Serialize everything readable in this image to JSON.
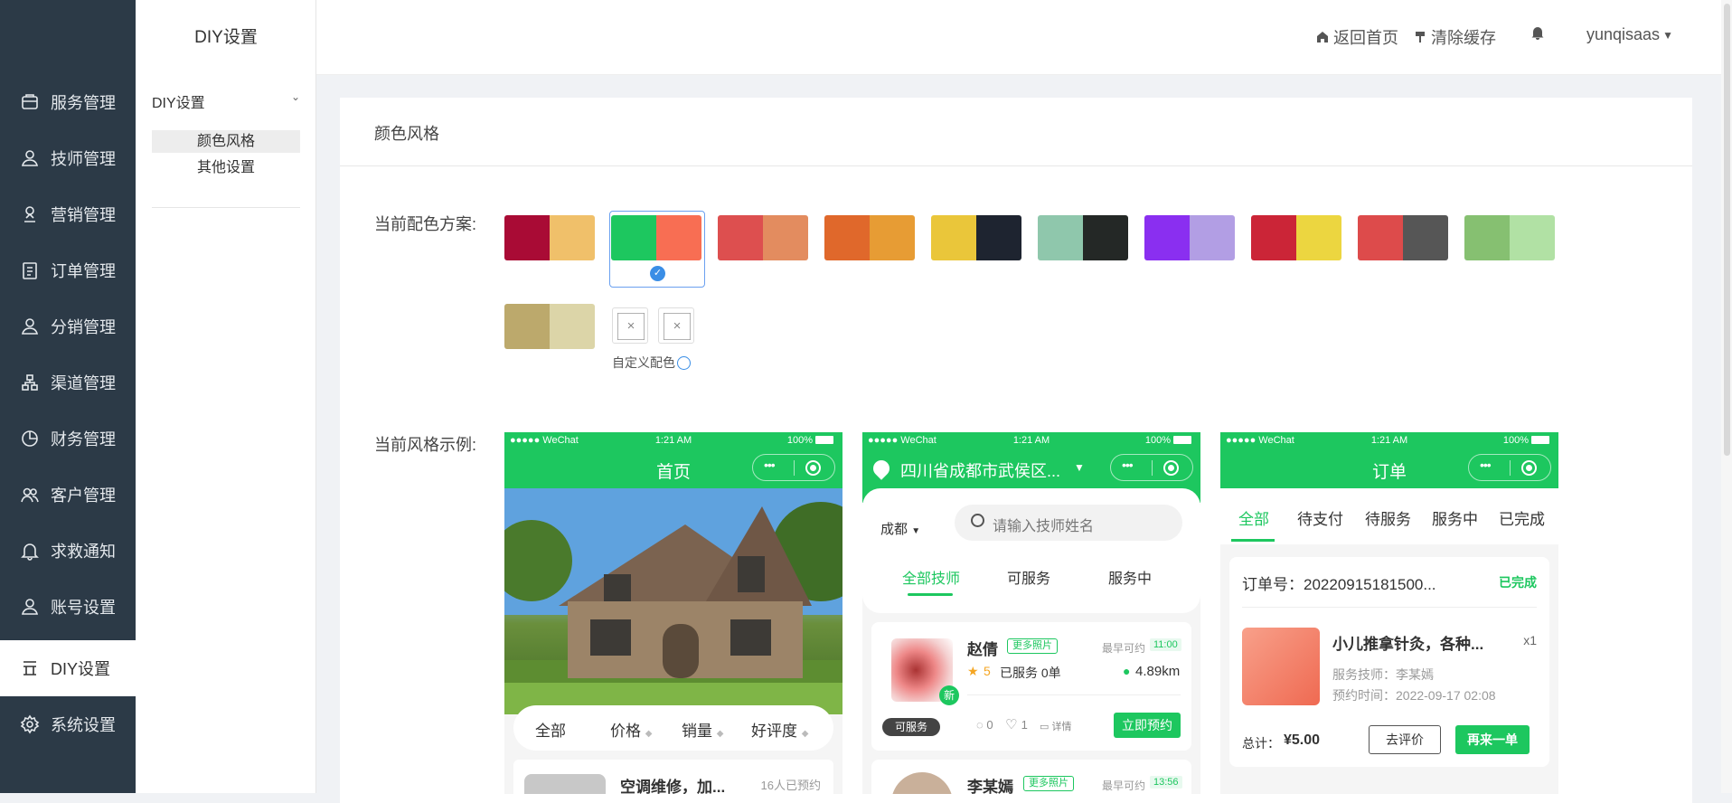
{
  "sidebar": {
    "items": [
      {
        "label": "服务管理",
        "icon": "service-icon"
      },
      {
        "label": "技师管理",
        "icon": "user-icon"
      },
      {
        "label": "营销管理",
        "icon": "marketing-icon"
      },
      {
        "label": "订单管理",
        "icon": "order-icon"
      },
      {
        "label": "分销管理",
        "icon": "distribution-icon"
      },
      {
        "label": "渠道管理",
        "icon": "channel-icon"
      },
      {
        "label": "财务管理",
        "icon": "pie-chart-icon"
      },
      {
        "label": "客户管理",
        "icon": "customers-icon"
      },
      {
        "label": "求救通知",
        "icon": "bell-icon"
      },
      {
        "label": "账号设置",
        "icon": "account-icon"
      },
      {
        "label": "DIY设置",
        "icon": "diy-icon"
      },
      {
        "label": "系统设置",
        "icon": "gear-icon"
      }
    ],
    "active": "DIY设置"
  },
  "subnav": {
    "title": "DIY设置",
    "group": "DIY设置",
    "items": [
      "颜色风格",
      "其他设置"
    ],
    "active": "颜色风格"
  },
  "topbar": {
    "home": "返回首页",
    "clear_cache": "清除缓存",
    "username": "yunqisaas"
  },
  "content": {
    "card_title": "颜色风格",
    "scheme_label": "当前配色方案:",
    "example_label": "当前风格示例:",
    "custom_label": "自定义配色",
    "schemes": [
      [
        "#a90b35",
        "#f0c06a"
      ],
      [
        "#1dc75f",
        "#f86e53"
      ],
      [
        "#dd4f4f",
        "#e38c5f"
      ],
      [
        "#e0682b",
        "#e79c34"
      ],
      [
        "#eac63a",
        "#1e2430"
      ],
      [
        "#8fc7ac",
        "#242826"
      ],
      [
        "#8a2ff0",
        "#b29ee4"
      ],
      [
        "#cb2537",
        "#ecd640"
      ],
      [
        "#dd4b4b",
        "#565656"
      ],
      [
        "#86c071",
        "#b1e1a4"
      ],
      [
        "#bca96c",
        "#dcd5a8"
      ]
    ],
    "selected_scheme": 1
  },
  "phone1": {
    "status_left": "●●●●● WeChat",
    "time": "1:21 AM",
    "battery": "100%",
    "title": "首页",
    "filters": [
      "全部",
      "价格",
      "销量",
      "好评度"
    ],
    "product_name": "空调维修，加...",
    "product_count": "16人已预约"
  },
  "phone2": {
    "status_left": "●●●●● WeChat",
    "time": "1:21 AM",
    "battery": "100%",
    "location": "四川省成都市武侯区...",
    "city": "成都",
    "search_placeholder": "请输入技师姓名",
    "tabs": [
      "全部技师",
      "可服务",
      "服务中"
    ],
    "tech1": {
      "name": "赵倩",
      "tag": "更多照片",
      "earliest": "最早可约",
      "time": "11:00",
      "rating": "5",
      "served": "已服务 0单",
      "distance": "4.89km",
      "status": "可服务",
      "comments": "0",
      "likes": "1",
      "detail": "详情",
      "book": "立即预约",
      "new_badge": "新"
    },
    "tech2": {
      "name": "李某嫣",
      "tag": "更多照片",
      "earliest": "最早可约",
      "time": "13:56"
    }
  },
  "phone3": {
    "status_left": "●●●●● WeChat",
    "time": "1:21 AM",
    "battery": "100%",
    "title": "订单",
    "tabs": [
      "全部",
      "待支付",
      "待服务",
      "服务中",
      "已完成"
    ],
    "order_no": "订单号：20220915181500...",
    "order_status": "已完成",
    "item_name": "小儿推拿针灸，各种...",
    "qty": "x1",
    "tech": "服务技师：李某嫣",
    "booked": "预约时间：2022-09-17 02:08",
    "total_label": "总计：",
    "total": "¥5.00",
    "review": "去评价",
    "reorder": "再来一单"
  }
}
